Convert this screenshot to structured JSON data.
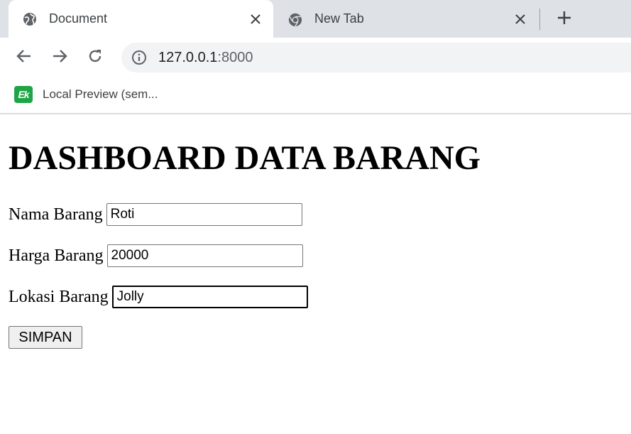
{
  "browser": {
    "tabs": [
      {
        "title": "Document",
        "icon": "globe-icon",
        "active": true
      },
      {
        "title": "New Tab",
        "icon": "chrome-icon",
        "active": false
      }
    ],
    "url": {
      "host": "127.0.0.1",
      "port": ":8000"
    },
    "bookmarks": [
      {
        "label": "Local Preview (sem...",
        "icon": "ek-icon",
        "icon_text": "Ek",
        "icon_color": "#1ea446"
      }
    ]
  },
  "page": {
    "title": "DASHBOARD DATA BARANG",
    "fields": [
      {
        "label": "Nama Barang",
        "value": "Roti"
      },
      {
        "label": "Harga Barang",
        "value": "20000"
      },
      {
        "label": "Lokasi Barang",
        "value": "Jolly"
      }
    ],
    "submit_label": "SIMPAN"
  }
}
